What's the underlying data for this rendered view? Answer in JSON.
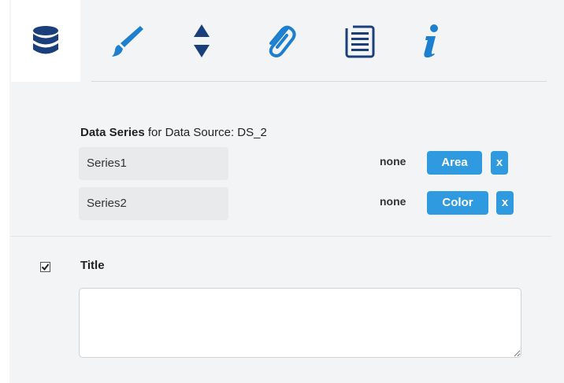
{
  "tabs": [
    {
      "id": "data",
      "icon": "database-icon",
      "active": true
    },
    {
      "id": "style",
      "icon": "paintbrush-icon",
      "active": false
    },
    {
      "id": "sort",
      "icon": "sort-arrows-icon",
      "active": false
    },
    {
      "id": "attach",
      "icon": "paperclip-icon",
      "active": false
    },
    {
      "id": "list",
      "icon": "list-icon",
      "active": false
    },
    {
      "id": "info",
      "icon": "info-icon",
      "active": false
    }
  ],
  "colors": {
    "accent": "#2f9ae0",
    "icon": "#1f7fcf",
    "icon_dark": "#1a3f7a"
  },
  "panel": {
    "title_bold": "Data Series",
    "title_rest": "for Data Source: DS_2"
  },
  "series": [
    {
      "name": "Series1",
      "status": "none",
      "button": "Area",
      "remove": "x"
    },
    {
      "name": "Series2",
      "status": "none",
      "button": "Color",
      "remove": "x"
    }
  ],
  "title_section": {
    "checked": true,
    "label": "Title",
    "value": ""
  }
}
